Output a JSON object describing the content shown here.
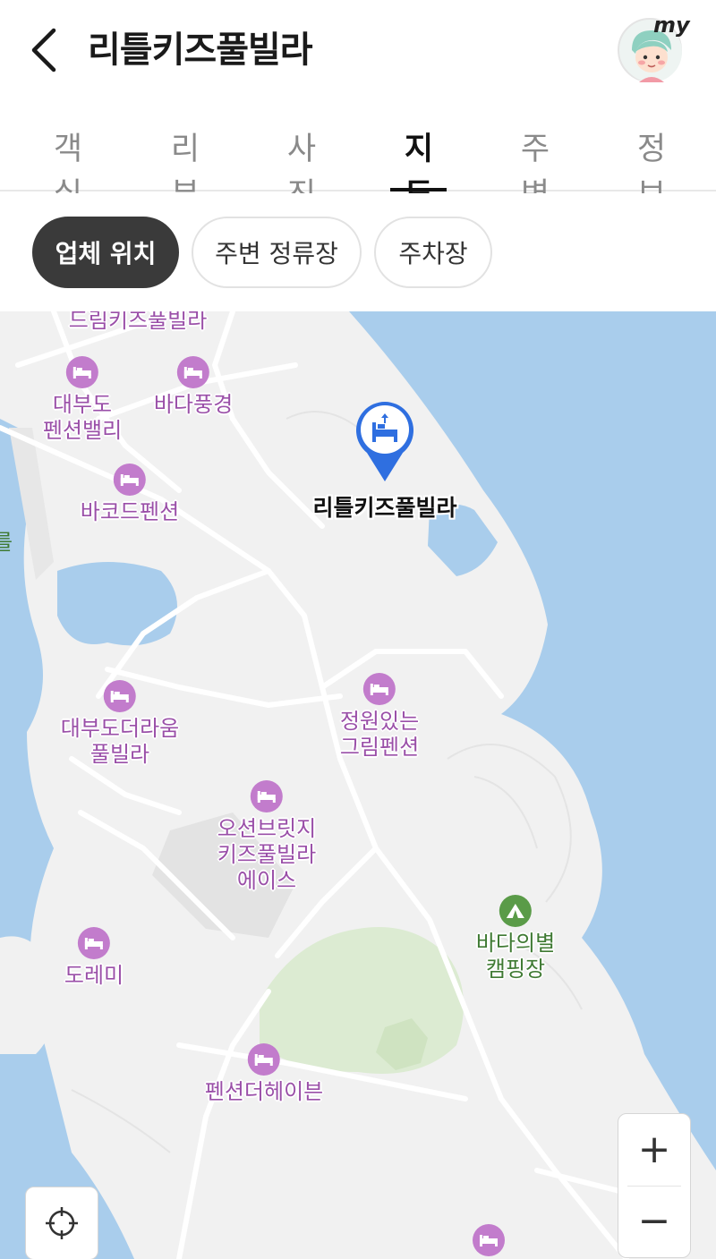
{
  "header": {
    "title": "리틀키즈풀빌라",
    "avatar_badge": "my"
  },
  "tabs": [
    {
      "label": "객실",
      "active": false
    },
    {
      "label": "리뷰",
      "active": false
    },
    {
      "label": "사진",
      "active": false
    },
    {
      "label": "지도",
      "active": true
    },
    {
      "label": "주변",
      "active": false
    },
    {
      "label": "정보",
      "active": false
    }
  ],
  "chips": [
    {
      "label": "업체 위치",
      "active": true
    },
    {
      "label": "주변 정류장",
      "active": false
    },
    {
      "label": "주차장",
      "active": false
    }
  ],
  "map": {
    "selected_place": "리틀키즈풀빌라",
    "pois": [
      {
        "label": "드림키즈풀빌라",
        "type": "lodging"
      },
      {
        "label": "대부도\n펜션밸리",
        "type": "lodging"
      },
      {
        "label": "바다풍경",
        "type": "lodging"
      },
      {
        "label": "바코드펜션",
        "type": "lodging"
      },
      {
        "label": "대부도더라움\n풀빌라",
        "type": "lodging"
      },
      {
        "label": "정원있는\n그림펜션",
        "type": "lodging"
      },
      {
        "label": "오션브릿지\n키즈풀빌라\n에이스",
        "type": "lodging"
      },
      {
        "label": "도레미",
        "type": "lodging"
      },
      {
        "label": "펜션더헤이븐",
        "type": "lodging"
      },
      {
        "label": "바다의별\n캠핑장",
        "type": "camping"
      }
    ],
    "edge_label": "를",
    "colors": {
      "water": "#a9cdec",
      "land": "#f2f2f2",
      "park": "#dcebd2",
      "lodging_icon": "#c27ccc",
      "lodging_text": "#9a4fa8",
      "camp_icon": "#5a9b48",
      "marker": "#2f6fe0"
    }
  },
  "controls": {
    "zoom_in": "+",
    "zoom_out": "−"
  },
  "icons": {
    "back": "chevron-left-icon",
    "locate": "crosshair-icon",
    "marker": "lodging-pin-icon"
  }
}
